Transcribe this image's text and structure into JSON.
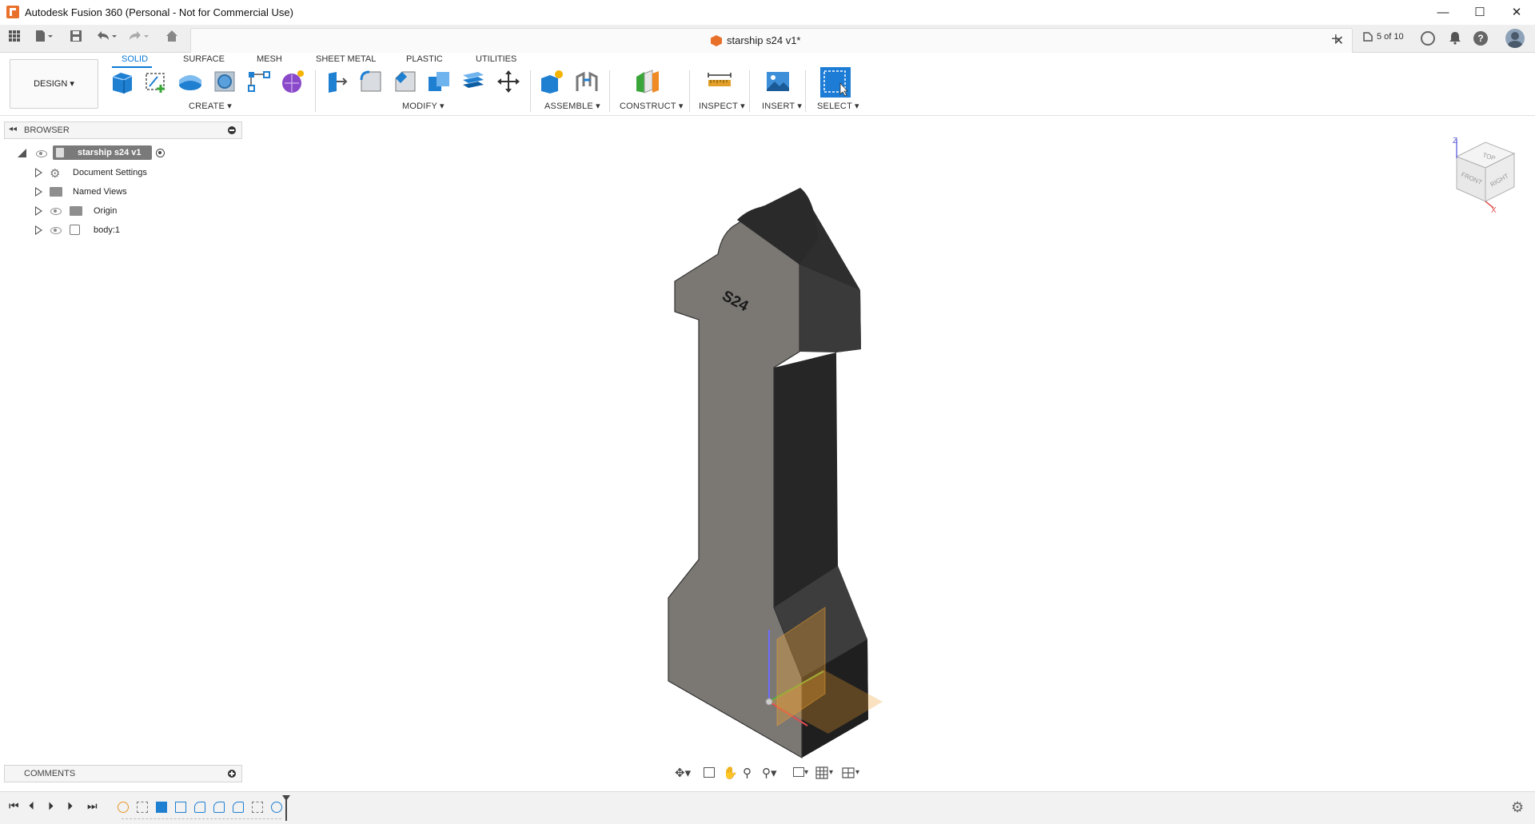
{
  "window": {
    "title": "Autodesk Fusion 360 (Personal - Not for Commercial Use)",
    "minimize": "—",
    "maximize": "☐",
    "close": "✕"
  },
  "tabbar": {
    "document_title": "starship s24 v1*",
    "close_glyph": "✕",
    "new_tab_glyph": "+",
    "version_counter": "5 of 10"
  },
  "toolbar": {
    "workspace": "DESIGN ▾",
    "tabs": [
      "SOLID",
      "SURFACE",
      "MESH",
      "SHEET METAL",
      "PLASTIC",
      "UTILITIES"
    ],
    "groups": [
      "CREATE ▾",
      "MODIFY ▾",
      "ASSEMBLE ▾",
      "CONSTRUCT ▾",
      "INSPECT ▾",
      "INSERT ▾",
      "SELECT ▾"
    ]
  },
  "browser": {
    "title": "BROWSER",
    "root": "starship s24 v1",
    "items": [
      "Document Settings",
      "Named Views",
      "Origin",
      "body:1"
    ]
  },
  "comments": {
    "title": "COMMENTS"
  },
  "model": {
    "engraving": "S24"
  },
  "viewcube": {
    "top": "TOP",
    "front": "FRONT",
    "right": "RIGHT",
    "axis_x": "X",
    "axis_z": "Z"
  },
  "colors": {
    "accent": "#0a7ad6",
    "brand": "#e8702a",
    "body_light": "#7d7a76",
    "body_dark": "#2b2b2b"
  }
}
